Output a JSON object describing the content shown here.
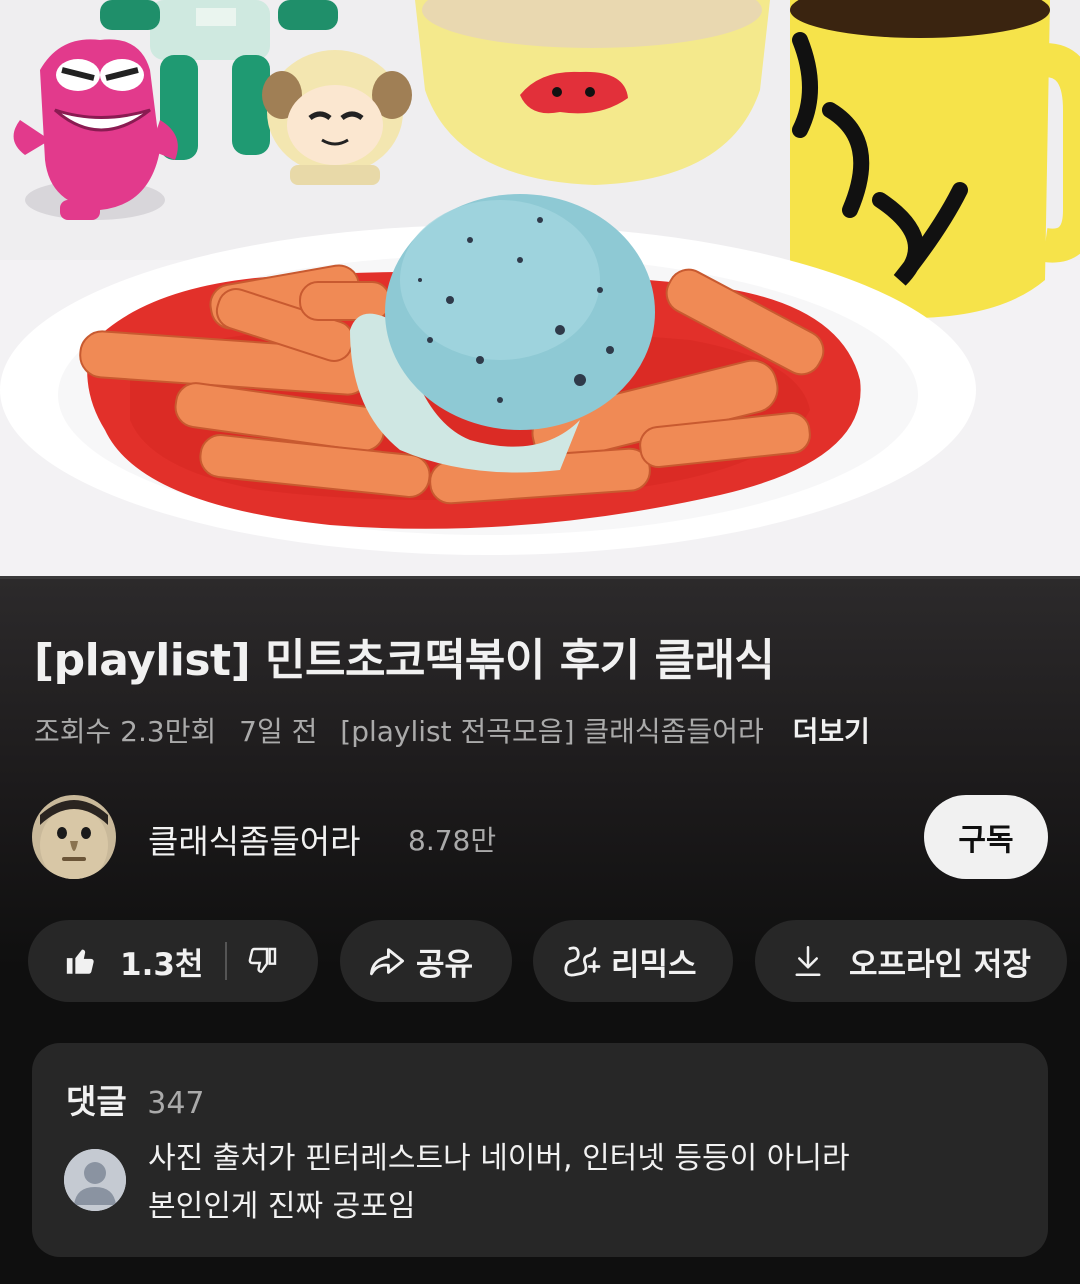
{
  "video": {
    "thumbnail_description_icon": "video-frame"
  },
  "title": "[playlist] 민트초코떡볶이 후기 클래식",
  "meta": {
    "views": "조회수 2.3만회",
    "age": "7일 전",
    "playlist": "[playlist 전곡모음] 클래식좀들어라",
    "more": "더보기"
  },
  "channel": {
    "name": "클래식좀들어라",
    "subscribers": "8.78만",
    "subscribe_label": "구독"
  },
  "actions": {
    "like_count": "1.3천",
    "share_label": "공유",
    "remix_label": "리믹스",
    "offline_label": "오프라인 저장"
  },
  "comments": {
    "title": "댓글",
    "count": "347",
    "top_comment_line1": "사진 출처가 핀터레스트나 네이버, 인터넷 등등이 아니라",
    "top_comment_line2": "본인인게 진짜 공포임"
  },
  "colors": {
    "background": "#0f0f0f",
    "pill": "#272727",
    "subscribe_bg": "#f1f1f1",
    "secondary_text": "#aaaaaa"
  }
}
